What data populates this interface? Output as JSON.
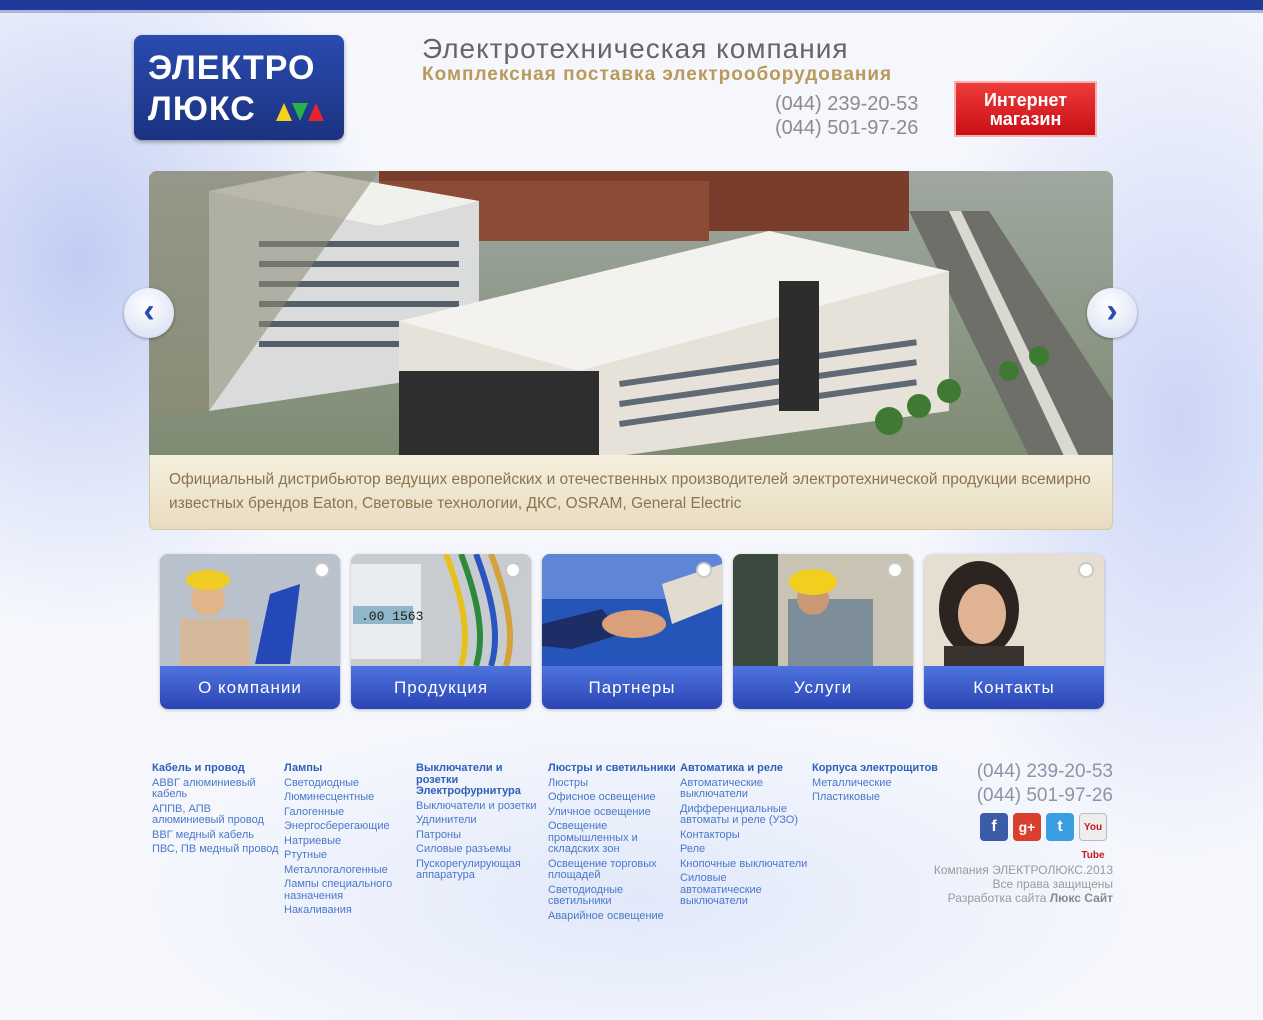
{
  "logo": {
    "line1": "ЭЛЕКТРО",
    "line2": "ЛЮКС"
  },
  "header": {
    "tagline1": "Электротехническая компания",
    "tagline2": "Комплексная поставка электрооборудования",
    "phones": [
      "(044) 239-20-53",
      "(044) 501-97-26"
    ],
    "shop_label_line1": "Интернет",
    "shop_label_line2": "магазин"
  },
  "slider": {
    "caption": "Официальный дистрибьютор ведущих европейских и отечественных производителей электротехнической продукции всемирно известных брендов Eaton, Световые технологии, ДКС, OSRAM, General Electric"
  },
  "tiles": [
    "О компании",
    "Продукция",
    "Партнеры",
    "Услуги",
    "Контакты"
  ],
  "footer": {
    "columns": [
      {
        "head": "Кабель и провод",
        "items": [
          "АВВГ алюминиевый кабель",
          "АППВ, АПВ алюминиевый провод",
          "ВВГ медный кабель",
          "ПВС, ПВ медный провод"
        ]
      },
      {
        "head": "Лампы",
        "items": [
          "Светодиодные",
          "Люминесцентные",
          "Галогенные",
          "Энергосберегающие",
          "Натриевые",
          "Ртутные",
          "Металлогалогенные",
          "Лампы специального назначения",
          "Накаливания"
        ]
      },
      {
        "head": "Выключатели и розетки Электрофурнитура",
        "items": [
          "Выключатели и розетки",
          "Удлинители",
          "Патроны",
          "Силовые разъемы",
          "Пускорегулирующая аппаратура"
        ]
      },
      {
        "head": "Люстры и светильники",
        "items": [
          "Люстры",
          "Офисное освещение",
          "Уличное освещение",
          "Освещение промышленных и складских зон",
          "Освещение торговых площадей",
          "Светодиодные светильники",
          "Аварийное освещение"
        ]
      },
      {
        "head": "Автоматика и реле",
        "items": [
          "Автоматические выключатели",
          "Дифференциальные автоматы и реле (УЗО)",
          "Контакторы",
          "Реле",
          "Кнопочные выключатели",
          "Силовые автоматические выключатели"
        ]
      },
      {
        "head": "Корпуса электрощитов",
        "items": [
          "Металлические",
          "Пластиковые"
        ]
      }
    ],
    "phones": [
      "(044) 239-20-53",
      "(044) 501-97-26"
    ],
    "social": [
      "f",
      "g+",
      "t",
      "You Tube"
    ],
    "copyright1": "Компания ЭЛЕКТРОЛЮКС.2013",
    "copyright2": "Все права защищены",
    "dev_prefix": "Разработка сайта",
    "dev_name": "Люкс Сайт"
  },
  "colors": {
    "brand_blue": "#2a4bb0",
    "tile_blue": "#3a5ccc",
    "accent_red": "#d8141b",
    "gold": "#b89a5a"
  }
}
